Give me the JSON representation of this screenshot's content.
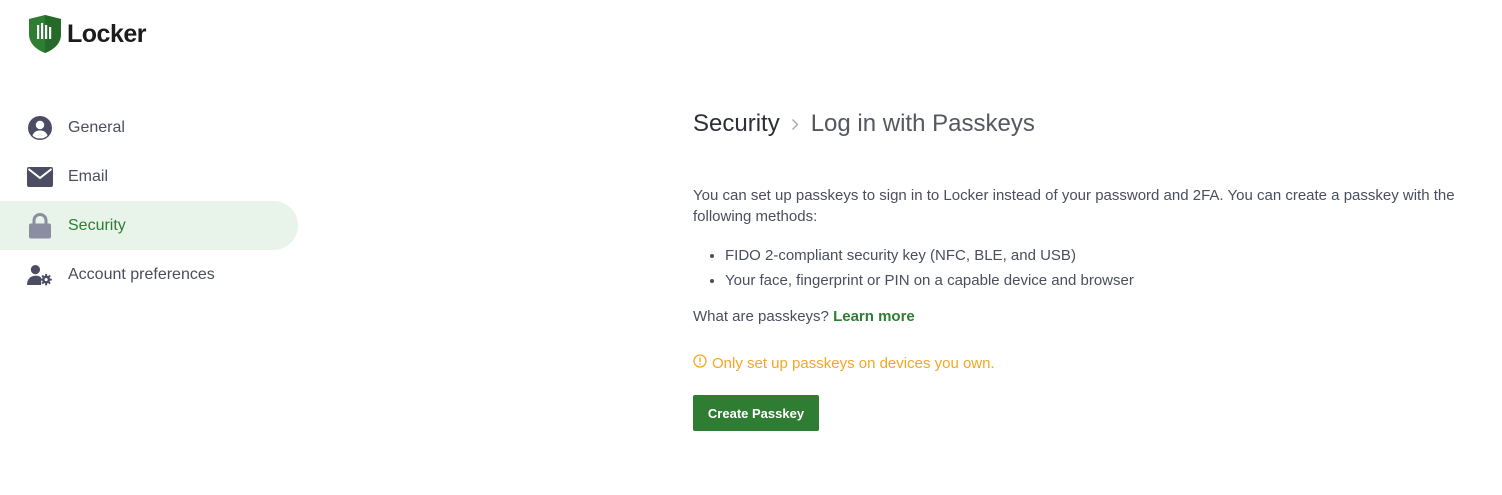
{
  "brand": {
    "name": "Locker",
    "color": "#2e7d32"
  },
  "sidebar": {
    "items": [
      {
        "label": "General",
        "icon": "user-circle-icon",
        "active": false
      },
      {
        "label": "Email",
        "icon": "envelope-icon",
        "active": false
      },
      {
        "label": "Security",
        "icon": "lock-icon",
        "active": true
      },
      {
        "label": "Account preferences",
        "icon": "user-gear-icon",
        "active": false
      }
    ]
  },
  "breadcrumb": {
    "root": "Security",
    "current": "Log in with Passkeys"
  },
  "content": {
    "intro": "You can set up passkeys to sign in to Locker instead of your password and 2FA. You can create a passkey with the following methods:",
    "methods": [
      "FIDO 2-compliant security key (NFC, BLE, and USB)",
      "Your face, fingerprint or PIN on a capable device and browser"
    ],
    "question": "What are passkeys?",
    "learn_more": "Learn more",
    "warning": "Only set up passkeys on devices you own.",
    "create_button": "Create Passkey"
  },
  "colors": {
    "accent": "#2e7d32",
    "active_bg": "#e8f3ea",
    "warning": "#f5a623"
  }
}
